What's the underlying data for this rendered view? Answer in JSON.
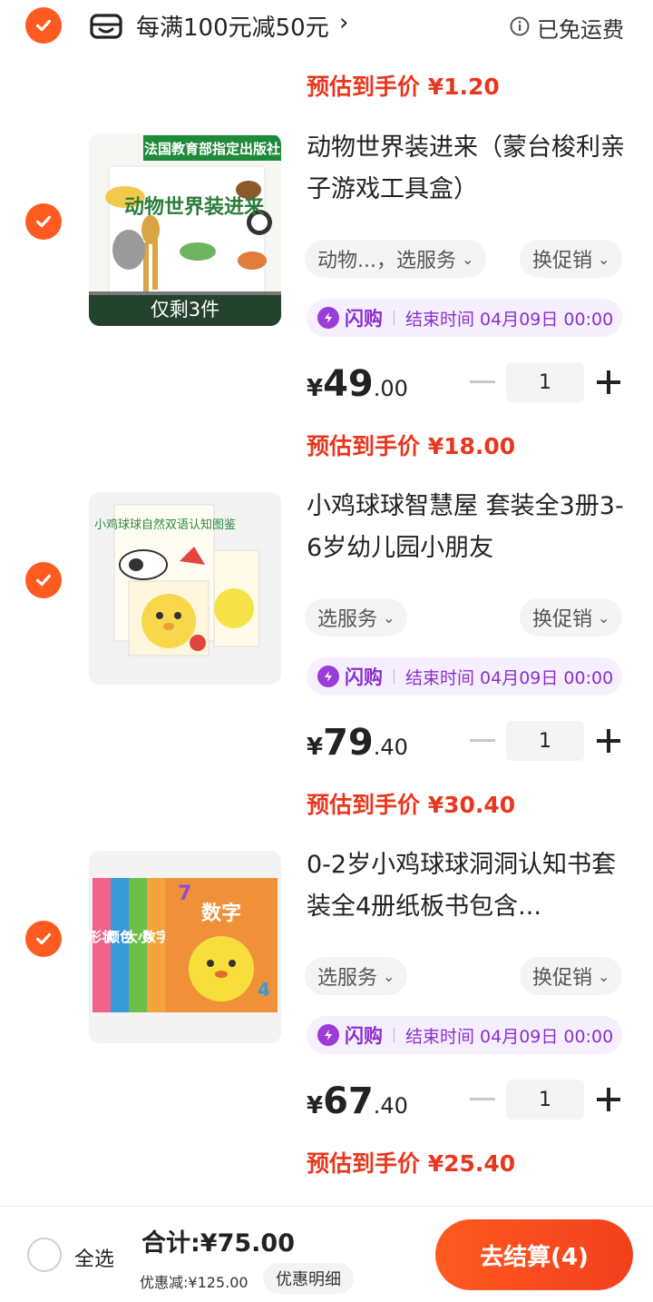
{
  "store_promo": {
    "promo_text": "每满100元减50元",
    "chevron": "›",
    "shipping_status": "已免运费",
    "estimated_price": "预估到手价 ¥1.20"
  },
  "items": [
    {
      "thumbnail_label": "动物世界装进来",
      "thumbnail_banner": "法国教育部指定出版社",
      "stock_badge": "仅剩3件",
      "title": "动物世界装进来（蒙台梭利亲子游戏工具盒）",
      "service_option": "动物...，选服务",
      "promo_option": "换促销",
      "flash_label": "闪购",
      "flash_time": "结束时间 04月09日 00:00",
      "price_symbol": "¥",
      "price_int": "49",
      "price_dec": ".00",
      "quantity": "1",
      "estimated_price": "预估到手价 ¥18.00"
    },
    {
      "thumbnail_label": "小鸡球球自然双语认知图鉴",
      "title": "小鸡球球智慧屋 套装全3册3-6岁幼儿园小朋友",
      "service_option": "选服务",
      "promo_option": "换促销",
      "flash_label": "闪购",
      "flash_time": "结束时间 04月09日 00:00",
      "price_symbol": "¥",
      "price_int": "79",
      "price_dec": ".40",
      "quantity": "1",
      "estimated_price": "预估到手价 ¥30.40"
    },
    {
      "thumbnail_label": "数字",
      "thumbnail_spines": [
        "形状",
        "颜色",
        "大小",
        "数字"
      ],
      "title": "0-2岁小鸡球球洞洞认知书套装全4册纸板书包含...",
      "service_option": "选服务",
      "promo_option": "换促销",
      "flash_label": "闪购",
      "flash_time": "结束时间 04月09日 00:00",
      "price_symbol": "¥",
      "price_int": "67",
      "price_dec": ".40",
      "quantity": "1",
      "estimated_price": "预估到手价 ¥25.40"
    }
  ],
  "bottom_bar": {
    "select_all_label": "全选",
    "total_text": "合计:¥75.00",
    "discount_text": "优惠减:¥125.00",
    "discount_detail_label": "优惠明细",
    "checkout_label": "去结算(4)"
  },
  "colors": {
    "accent": "#ff5a1f",
    "estimate_red": "#e8371e",
    "flash_purple": "#8b2fd0"
  }
}
